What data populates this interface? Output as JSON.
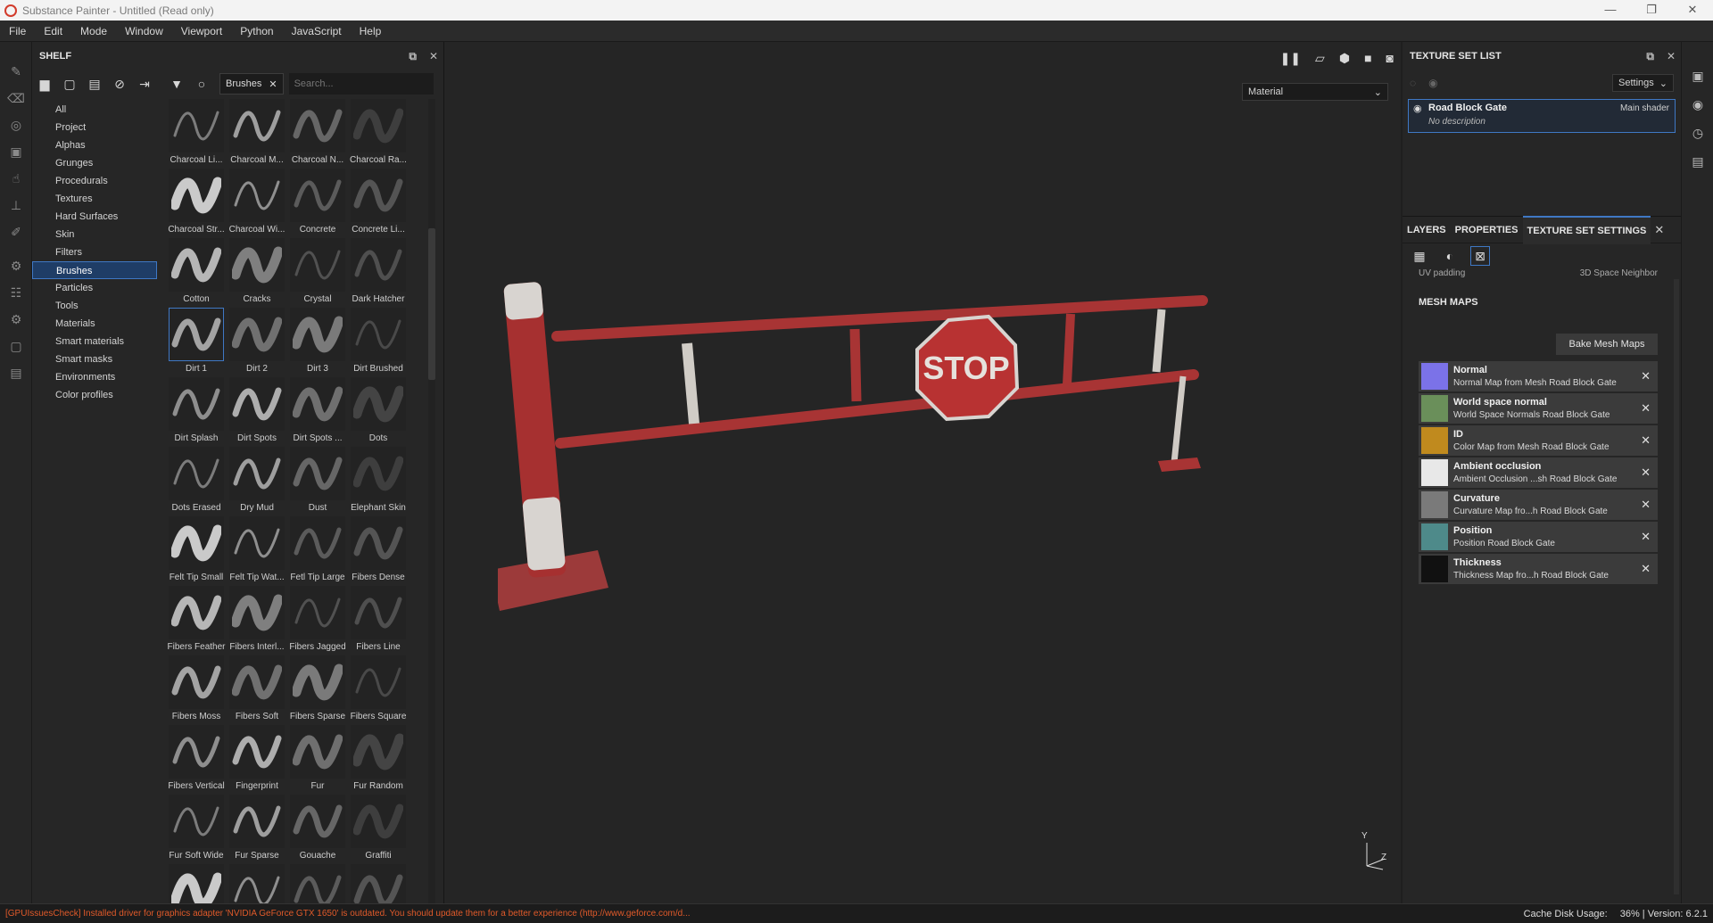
{
  "window": {
    "title": "Substance Painter - Untitled (Read only)",
    "controls": [
      "—",
      "❐",
      "✕"
    ]
  },
  "menu": [
    "File",
    "Edit",
    "Mode",
    "Window",
    "Viewport",
    "Python",
    "JavaScript",
    "Help"
  ],
  "shelf": {
    "title": "SHELF",
    "filter_tag": "Brushes",
    "search_placeholder": "Search...",
    "categories": [
      "All",
      "Project",
      "Alphas",
      "Grunges",
      "Procedurals",
      "Textures",
      "Hard Surfaces",
      "Skin",
      "Filters",
      "Brushes",
      "Particles",
      "Tools",
      "Materials",
      "Smart materials",
      "Smart masks",
      "Environments",
      "Color profiles"
    ],
    "active_category": "Brushes",
    "brushes": [
      "Charcoal Li...",
      "Charcoal M...",
      "Charcoal N...",
      "Charcoal Ra...",
      "Charcoal Str...",
      "Charcoal Wi...",
      "Concrete",
      "Concrete Li...",
      "Cotton",
      "Cracks",
      "Crystal",
      "Dark Hatcher",
      "Dirt 1",
      "Dirt 2",
      "Dirt 3",
      "Dirt Brushed",
      "Dirt Splash",
      "Dirt Spots",
      "Dirt Spots ...",
      "Dots",
      "Dots Erased",
      "Dry Mud",
      "Dust",
      "Elephant Skin",
      "Felt Tip Small",
      "Felt Tip Wat...",
      "Fetl Tip Large",
      "Fibers Dense",
      "Fibers Feather",
      "Fibers Interl...",
      "Fibers Jagged",
      "Fibers Line",
      "Fibers Moss",
      "Fibers Soft",
      "Fibers Sparse",
      "Fibers Square",
      "Fibers Vertical",
      "Fingerprint",
      "Fur",
      "Fur Random",
      "Fur Soft Wide",
      "Fur Sparse",
      "Gouache",
      "Graffiti",
      "",
      "",
      "",
      ""
    ],
    "selected_brush": "Dirt 1"
  },
  "viewport": {
    "channel_select": "Material",
    "sign_text": "STOP",
    "axis_label": "Y",
    "axis_label_z": "Z"
  },
  "texture_set_list": {
    "title": "TEXTURE SET LIST",
    "settings_label": "Settings",
    "set_name": "Road Block Gate",
    "shader": "Main shader",
    "description": "No description"
  },
  "properties": {
    "tabs": [
      "LAYERS",
      "PROPERTIES",
      "TEXTURE SET SETTINGS"
    ],
    "active_tab": "TEXTURE SET SETTINGS",
    "uv_padding_label": "UV padding",
    "uv_padding_value": "3D Space Neighbor",
    "section_title": "MESH MAPS",
    "bake_button": "Bake Mesh Maps",
    "mesh_maps": [
      {
        "name": "Normal",
        "desc": "Normal Map from Mesh Road Block Gate",
        "color": "#7b72e8"
      },
      {
        "name": "World space normal",
        "desc": "World Space Normals Road Block Gate",
        "color": "#6a8f5a"
      },
      {
        "name": "ID",
        "desc": "Color Map from Mesh Road Block Gate",
        "color": "#c08a1e"
      },
      {
        "name": "Ambient occlusion",
        "desc": "Ambient Occlusion ...sh Road Block Gate",
        "color": "#e8e8e8"
      },
      {
        "name": "Curvature",
        "desc": "Curvature Map fro...h Road Block Gate",
        "color": "#7a7a7a"
      },
      {
        "name": "Position",
        "desc": "Position Road Block Gate",
        "color": "#4e8a8a"
      },
      {
        "name": "Thickness",
        "desc": "Thickness Map fro...h Road Block Gate",
        "color": "#111111"
      }
    ]
  },
  "status": {
    "warning": "[GPUIssuesCheck] Installed driver for graphics adapter 'NVIDIA GeForce GTX 1650' is outdated. You should update them for a better experience (http://www.geforce.com/d...",
    "cache_label": "Cache Disk Usage:",
    "cache_value": "36% | Version: 6.2.1"
  },
  "colors": {
    "accent": "#3f78c4",
    "warning": "#e05a2a",
    "barrier_red": "#b83232"
  }
}
